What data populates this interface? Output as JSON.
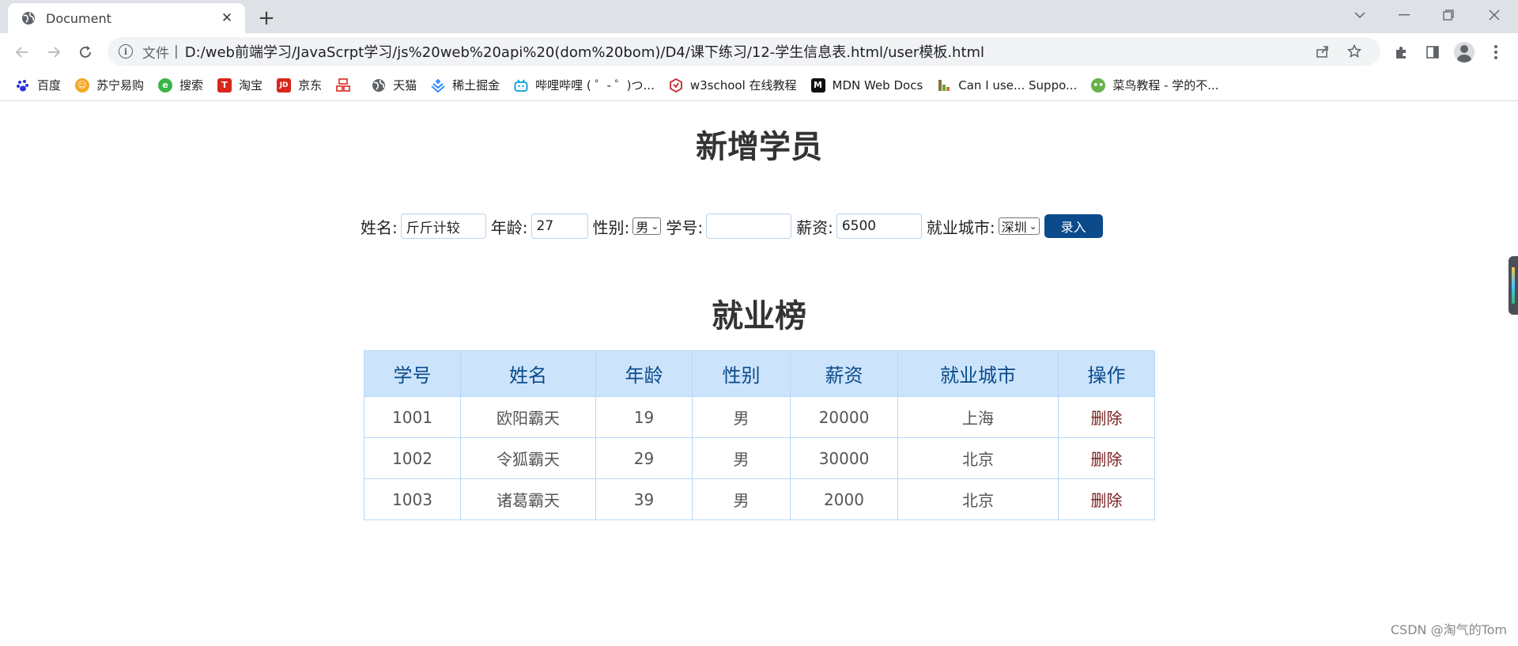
{
  "browser": {
    "tab_title": "Document",
    "url_scheme": "文件",
    "url_separator": "|",
    "url": "D:/web前端学习/JavaScrpt学习/js%20web%20api%20(dom%20bom)/D4/课下练习/12-学生信息表.html/user模板.html"
  },
  "bookmarks": [
    {
      "label": "百度",
      "icon": "baidu-icon",
      "color": "#2932e1"
    },
    {
      "label": "苏宁易购",
      "icon": "suning-icon",
      "color": "#f5a623"
    },
    {
      "label": "搜索",
      "icon": "search-engine-icon",
      "color": "#3bb54a"
    },
    {
      "label": "淘宝",
      "icon": "taobao-icon",
      "color": "#d8271c"
    },
    {
      "label": "京东",
      "icon": "jd-icon",
      "color": "#d8271c"
    },
    {
      "label": "",
      "icon": "grid-icon",
      "color": "#d8271c"
    },
    {
      "label": "天猫",
      "icon": "globe-icon",
      "color": "#5f6368"
    },
    {
      "label": "稀土掘金",
      "icon": "juejin-icon",
      "color": "#1e80ff"
    },
    {
      "label": "哔哩哔哩 ( ゜- ゜)つ...",
      "icon": "bilibili-icon",
      "color": "#00a1d6"
    },
    {
      "label": "w3school 在线教程",
      "icon": "w3school-icon",
      "color": "#c0262d"
    },
    {
      "label": "MDN Web Docs",
      "icon": "mdn-icon",
      "color": "#111111"
    },
    {
      "label": "Can I use... Suppo...",
      "icon": "caniuse-icon",
      "color": "#8b6f3b"
    },
    {
      "label": "菜鸟教程 - 学的不...",
      "icon": "runoob-icon",
      "color": "#67b04a"
    }
  ],
  "form": {
    "title": "新增学员",
    "name_label": "姓名:",
    "name_value": "斤斤计较",
    "age_label": "年龄:",
    "age_value": "27",
    "gender_label": "性别:",
    "gender_value": "男",
    "id_label": "学号:",
    "id_value": "",
    "salary_label": "薪资:",
    "salary_value": "6500",
    "city_label": "就业城市:",
    "city_value": "深圳",
    "submit_label": "录入"
  },
  "table": {
    "title": "就业榜",
    "headers": [
      "学号",
      "姓名",
      "年龄",
      "性别",
      "薪资",
      "就业城市",
      "操作"
    ],
    "rows": [
      [
        "1001",
        "欧阳霸天",
        "19",
        "男",
        "20000",
        "上海",
        "删除"
      ],
      [
        "1002",
        "令狐霸天",
        "29",
        "男",
        "30000",
        "北京",
        "删除"
      ],
      [
        "1003",
        "诸葛霸天",
        "39",
        "男",
        "2000",
        "北京",
        "删除"
      ]
    ]
  },
  "watermark": "CSDN @淘气的Tom"
}
